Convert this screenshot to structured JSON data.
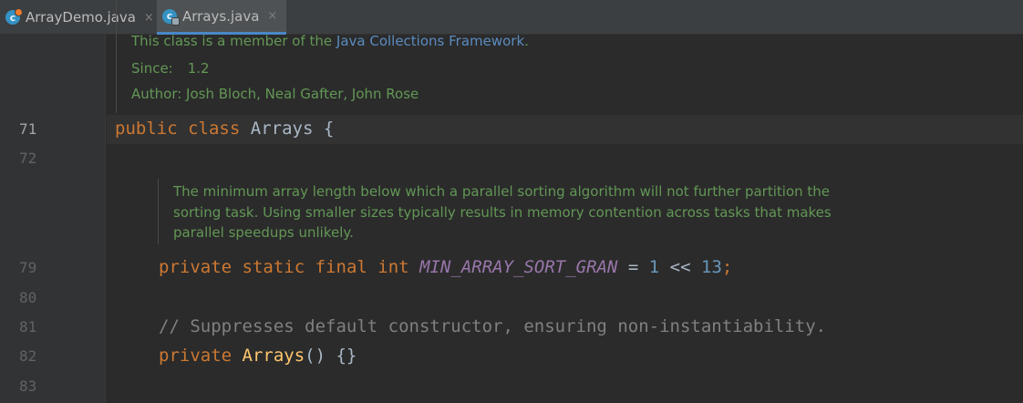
{
  "tabs": [
    {
      "label": "ArrayDemo.java",
      "close": "×",
      "active": false
    },
    {
      "label": "Arrays.java",
      "close": "×",
      "active": true
    }
  ],
  "javadoc_top": {
    "member_prefix": "This class is a member of the ",
    "member_link": "Java Collections Framework",
    "member_suffix": ".",
    "since_label": "Since:",
    "since_value": "1.2",
    "author": "Author: Josh Bloch, Neal Gafter, John Rose"
  },
  "line_numbers": [
    "71",
    "72",
    "79",
    "80",
    "81",
    "82",
    "83"
  ],
  "code": {
    "line71": {
      "kw1": "public",
      "kw2": "class",
      "name": "Arrays",
      "brace": "{"
    },
    "line79": {
      "kw1": "private",
      "kw2": "static",
      "kw3": "final",
      "kw4": "int",
      "const": "MIN_ARRAY_SORT_GRAN",
      "eq": "=",
      "n1": "1",
      "op": "<<",
      "n2": "13",
      "semi": ";"
    },
    "line81": {
      "comment": "// Suppresses default constructor, ensuring non-instantiability."
    },
    "line82": {
      "kw1": "private",
      "fn": "Arrays",
      "rest": "() {}"
    }
  },
  "javadoc_block": {
    "lines": [
      "The minimum array length below which a parallel sorting algorithm will not further partition the",
      "sorting task. Using smaller sizes typically results in memory contention across tasks that makes",
      "parallel speedups unlikely."
    ]
  },
  "colors": {
    "background": "#2b2b2b",
    "keyword": "#cc7832",
    "doc_comment": "#629755",
    "constant": "#9876aa",
    "number": "#6897bb",
    "comment": "#808080",
    "method": "#ffc66d"
  },
  "icons": {
    "file_icon": "class-file-icon",
    "close_icon": "close-icon"
  }
}
